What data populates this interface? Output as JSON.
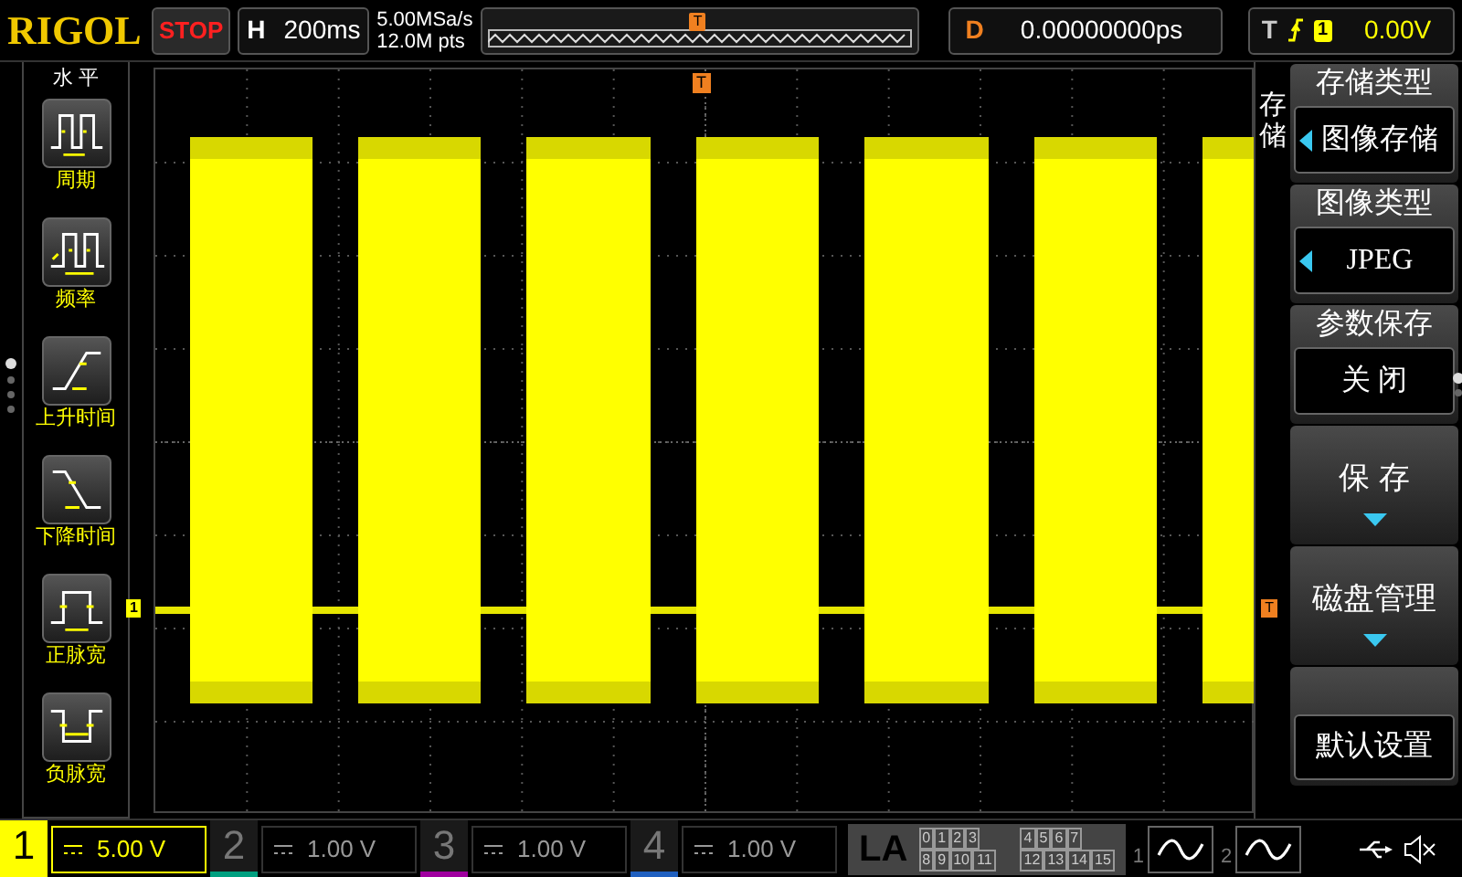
{
  "top_bar": {
    "logo": "RIGOL",
    "run_state": "STOP",
    "horizontal": {
      "label": "H",
      "value": "200ms"
    },
    "sample_rate": "5.00MSa/s",
    "memory_depth": "12.0M pts",
    "trigger_marker": "T",
    "delay": {
      "label": "D",
      "value": "0.00000000ps"
    },
    "trigger": {
      "label": "T",
      "source": "1",
      "level": "0.00V"
    }
  },
  "measure_panel": {
    "title": "水 平",
    "items": [
      {
        "kind": "period",
        "label": "周期"
      },
      {
        "kind": "frequency",
        "label": "频率"
      },
      {
        "kind": "rise",
        "label": "上升时间"
      },
      {
        "kind": "fall",
        "label": "下降时间"
      },
      {
        "kind": "positive_width",
        "label": "正脉宽"
      },
      {
        "kind": "negative_width",
        "label": "负脉宽"
      }
    ],
    "pages": [
      {
        "selected": true
      },
      {
        "selected": false
      },
      {
        "selected": false
      },
      {
        "selected": false
      }
    ]
  },
  "waveform": {
    "channel_marker": "1",
    "trigger_position_marker": "T",
    "trigger_level_marker": "T"
  },
  "menu": {
    "title": "存储",
    "items": [
      {
        "kind": "select",
        "label": "存储类型",
        "value": "图像存储",
        "arrow": true
      },
      {
        "kind": "select",
        "label": "图像类型",
        "value": "JPEG",
        "arrow": true
      },
      {
        "kind": "select",
        "label": "参数保存",
        "value": "关 闭",
        "arrow": false
      },
      {
        "kind": "submenu",
        "label": "保 存"
      },
      {
        "kind": "submenu",
        "label": "磁盘管理"
      },
      {
        "kind": "action",
        "label": "默认设置"
      }
    ],
    "pages": [
      {
        "selected": true
      },
      {
        "selected": false
      }
    ]
  },
  "channels": [
    {
      "number": "1",
      "scale": "5.00 V",
      "on": true,
      "color": "#ffff00"
    },
    {
      "number": "2",
      "scale": "1.00 V",
      "on": false,
      "color": "#00a080"
    },
    {
      "number": "3",
      "scale": "1.00 V",
      "on": false,
      "color": "#a000a0"
    },
    {
      "number": "4",
      "scale": "1.00 V",
      "on": false,
      "color": "#2060c0"
    }
  ],
  "la": {
    "label": "LA",
    "groups": [
      [
        "0",
        "1",
        "2",
        "3"
      ],
      [
        "4",
        "5",
        "6",
        "7"
      ],
      [
        "8",
        "9",
        "10",
        "11"
      ],
      [
        "12",
        "13",
        "14",
        "15"
      ]
    ]
  },
  "generators": [
    {
      "number": "1"
    },
    {
      "number": "2"
    }
  ]
}
